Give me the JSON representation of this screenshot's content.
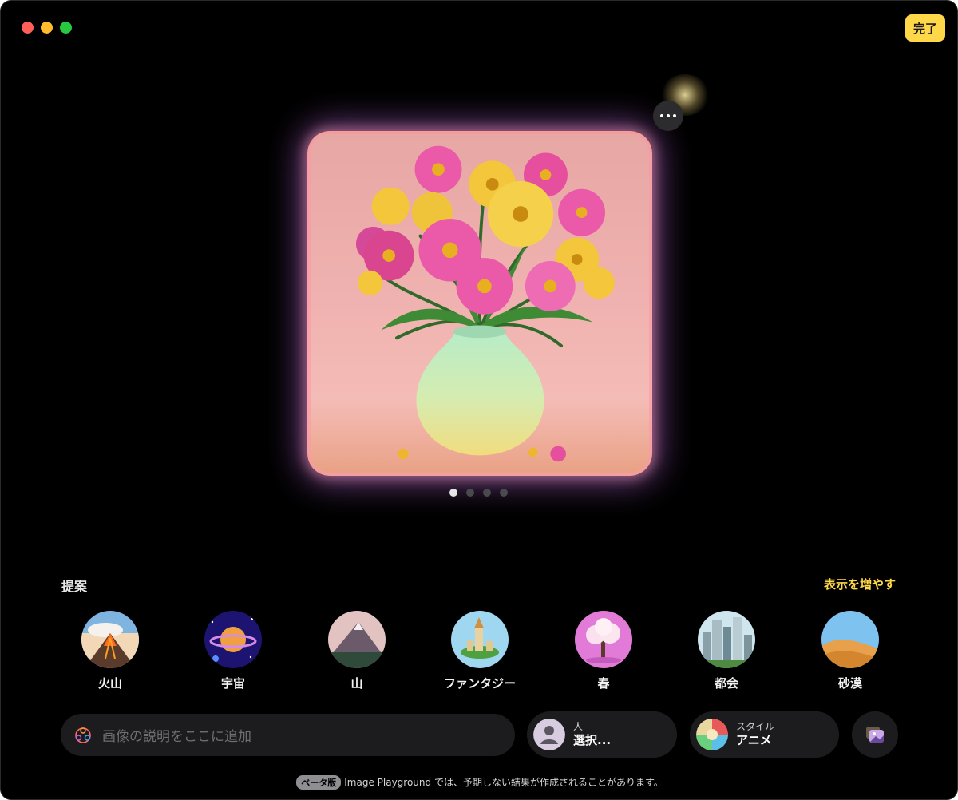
{
  "header": {
    "done_label": "完了",
    "more_icon": "ellipsis-icon"
  },
  "pager": {
    "count": 4,
    "active_index": 0
  },
  "suggestions": {
    "title": "提案",
    "more_label": "表示を増やす",
    "items": [
      {
        "label": "火山",
        "icon": "volcano-thumbnail"
      },
      {
        "label": "宇宙",
        "icon": "space-thumbnail"
      },
      {
        "label": "山",
        "icon": "mountain-thumbnail"
      },
      {
        "label": "ファンタジー",
        "icon": "fantasy-thumbnail"
      },
      {
        "label": "春",
        "icon": "spring-thumbnail"
      },
      {
        "label": "都会",
        "icon": "city-thumbnail"
      },
      {
        "label": "砂漠",
        "icon": "desert-thumbnail"
      }
    ]
  },
  "prompt": {
    "placeholder": "画像の説明をここに追加",
    "icon": "image-playground-icon"
  },
  "person": {
    "small": "人",
    "value": "選択..."
  },
  "style": {
    "small": "スタイル",
    "value": "アニメ"
  },
  "gallery": {
    "icon": "gallery-icon"
  },
  "footer": {
    "badge": "ベータ版",
    "text": "Image Playground では、予期しない結果が作成されることがあります。"
  },
  "colors": {
    "accent": "#ffd84a",
    "window_bg": "#000000",
    "control_bg": "#1c1c1e"
  }
}
